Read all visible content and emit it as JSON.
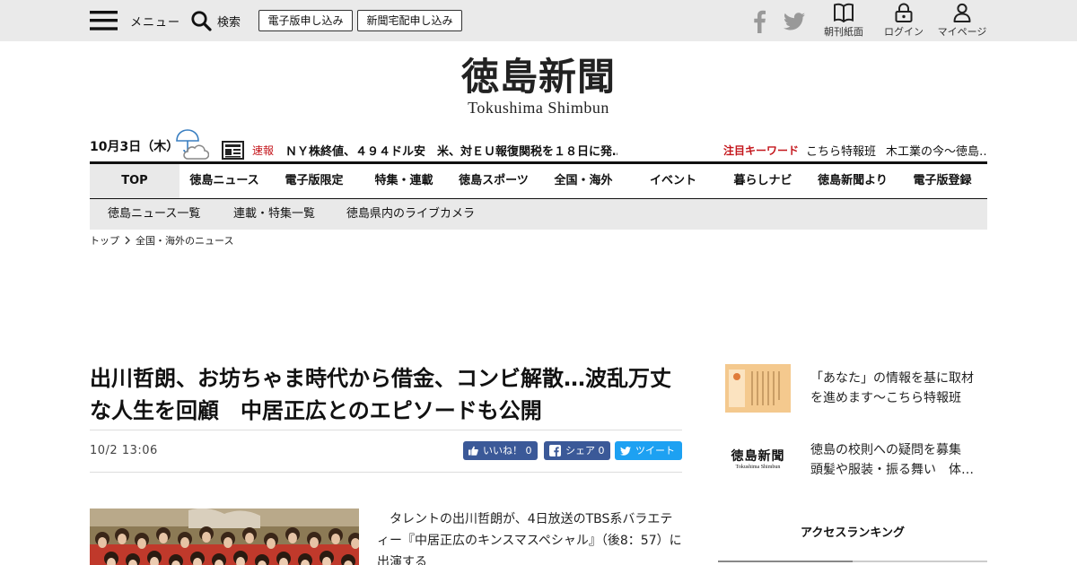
{
  "header": {
    "menu_label": "メニュー",
    "search_label": "検索",
    "digital_signup": "電子版申し込み",
    "delivery_signup": "新聞宅配申し込み",
    "morning_paper": "朝刊紙面",
    "login": "ログイン",
    "mypage": "マイページ",
    "icons": [
      "menu-icon",
      "search-icon",
      "facebook-icon",
      "twitter-icon",
      "book-icon",
      "lock-icon",
      "person-icon"
    ]
  },
  "logo": {
    "kanji": "徳島新聞",
    "roman": "Tokushima Shimbun"
  },
  "ticker": {
    "date": "10月3日（木）",
    "weather_icon": "rain-cloud-icon",
    "breaking_label": "速報",
    "breaking_text": "ＮＹ株終値、４９４ドル安　米、対ＥＵ報復関税を１８日に発…",
    "keyword_label": "注目キーワード",
    "keywords": [
      "こちら特報班",
      "木工業の今～徳島…"
    ]
  },
  "nav": {
    "items": [
      "TOP",
      "徳島ニュース",
      "電子版限定",
      "特集・連載",
      "徳島スポーツ",
      "全国・海外",
      "イベント",
      "暮らしナビ",
      "徳島新聞より",
      "電子版登録"
    ],
    "active": "TOP",
    "sub_items": [
      "徳島ニュース一覧",
      "連載・特集一覧",
      "徳島県内のライブカメラ"
    ]
  },
  "breadcrumb": {
    "home": "トップ",
    "current": "全国・海外のニュース"
  },
  "article": {
    "title": "出川哲朗、お坊ちゃま時代から借金、コンビ解散…波乱万丈な人生を回顧　中居正広とのエピソードも公開",
    "date": "10/2 13:06",
    "like_label": "いいね！ 0",
    "share_label": "シェア 0",
    "tweet_label": "ツイート",
    "body": "タレントの出川哲朗が、4日放送のTBS系バラエティー『中居正広のキンスマスペシャル』（後8：57）に出演する"
  },
  "sidebar": {
    "cards": [
      {
        "text": "「あなた」の情報を基に取材を進めます～こちら特報班"
      },
      {
        "text": "徳島の校則への疑問を募集　頭髪や服装・振る舞い　体…",
        "thumb_text": "徳島新聞",
        "thumb_sub": "Tokushima Shimbun"
      }
    ],
    "ranking_title": "アクセスランキング"
  },
  "colors": {
    "accent_red": "#c4161c",
    "facebook": "#3b5998",
    "twitter": "#1da1f2",
    "nav_bg": "#e9e9e9",
    "topbar_bg": "#eaeaea"
  }
}
